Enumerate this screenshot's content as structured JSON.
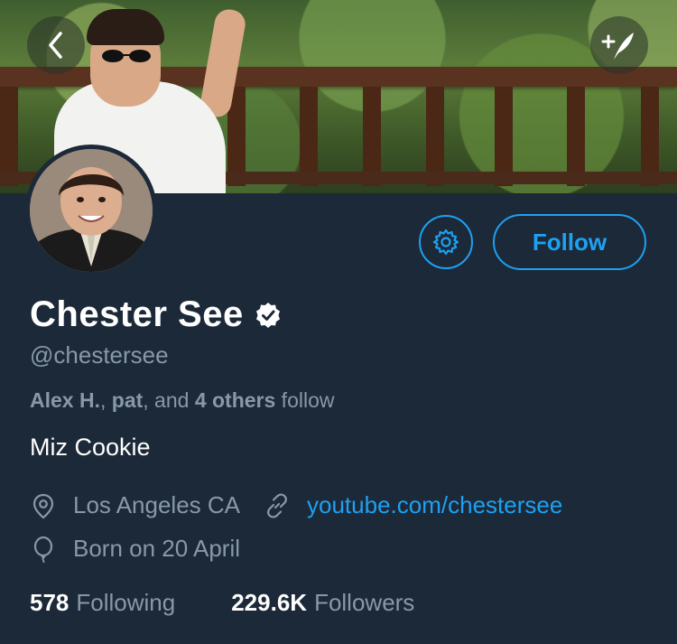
{
  "profile": {
    "name": "Chester See",
    "handle": "@chestersee",
    "bio": "Miz Cookie",
    "location": "Los Angeles CA",
    "website": "youtube.com/chestersee",
    "birthday": "Born on 20 April",
    "verified": true
  },
  "followed_by": {
    "user1": "Alex H.",
    "sep1": ", ",
    "user2": "pat",
    "sep2": ", and ",
    "others": "4 others",
    "suffix": " follow"
  },
  "stats": {
    "following_count": "578",
    "following_label": "Following",
    "followers_count": "229.6K",
    "followers_label": "Followers"
  },
  "actions": {
    "follow_label": "Follow"
  },
  "icons": {
    "back": "chevron-left-icon",
    "compose": "compose-tweet-icon",
    "settings": "gear-icon",
    "verified": "verified-badge-icon",
    "location": "location-pin-icon",
    "link": "link-icon",
    "birthday": "balloon-icon"
  },
  "colors": {
    "background": "#1c2938",
    "accent": "#1da1f2",
    "secondary_text": "#8899a6",
    "primary_text": "#ffffff"
  }
}
